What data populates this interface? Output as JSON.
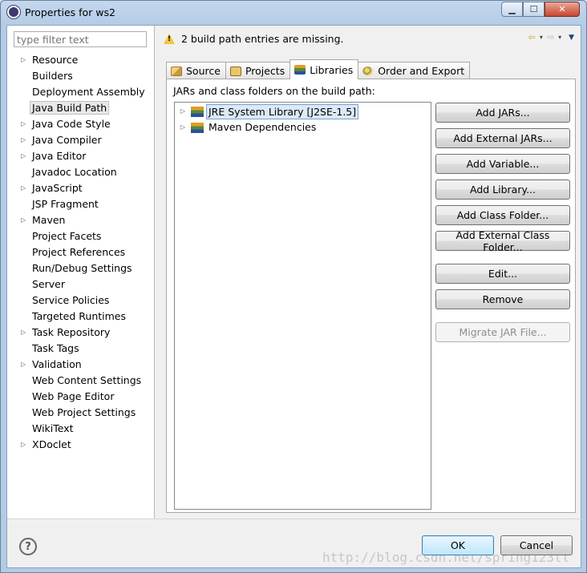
{
  "window": {
    "title": "Properties for ws2",
    "controls": {
      "minimize": "▁",
      "maximize": "☐",
      "close": "✕"
    }
  },
  "filter": {
    "placeholder": "type filter text"
  },
  "nav": {
    "items": [
      {
        "label": "Resource",
        "expandable": true
      },
      {
        "label": "Builders",
        "expandable": false
      },
      {
        "label": "Deployment Assembly",
        "expandable": false
      },
      {
        "label": "Java Build Path",
        "expandable": false,
        "selected": true
      },
      {
        "label": "Java Code Style",
        "expandable": true
      },
      {
        "label": "Java Compiler",
        "expandable": true
      },
      {
        "label": "Java Editor",
        "expandable": true
      },
      {
        "label": "Javadoc Location",
        "expandable": false
      },
      {
        "label": "JavaScript",
        "expandable": true
      },
      {
        "label": "JSP Fragment",
        "expandable": false
      },
      {
        "label": "Maven",
        "expandable": true
      },
      {
        "label": "Project Facets",
        "expandable": false
      },
      {
        "label": "Project References",
        "expandable": false
      },
      {
        "label": "Run/Debug Settings",
        "expandable": false
      },
      {
        "label": "Server",
        "expandable": false
      },
      {
        "label": "Service Policies",
        "expandable": false
      },
      {
        "label": "Targeted Runtimes",
        "expandable": false
      },
      {
        "label": "Task Repository",
        "expandable": true
      },
      {
        "label": "Task Tags",
        "expandable": false
      },
      {
        "label": "Validation",
        "expandable": true
      },
      {
        "label": "Web Content Settings",
        "expandable": false
      },
      {
        "label": "Web Page Editor",
        "expandable": false
      },
      {
        "label": "Web Project Settings",
        "expandable": false
      },
      {
        "label": "WikiText",
        "expandable": false
      },
      {
        "label": "XDoclet",
        "expandable": true
      }
    ]
  },
  "message": {
    "text": "2 build path entries are missing.",
    "icon": "warning-icon"
  },
  "history": {
    "back": "⇦",
    "forward": "⇨",
    "dropdown": "▾",
    "menu": "▼"
  },
  "tabs": [
    {
      "label": "Source",
      "icon": "source-folder-icon"
    },
    {
      "label": "Projects",
      "icon": "projects-icon"
    },
    {
      "label": "Libraries",
      "icon": "library-icon",
      "active": true
    },
    {
      "label": "Order and Export",
      "icon": "order-export-icon"
    }
  ],
  "libraries": {
    "subtitle": "JARs and class folders on the build path:",
    "tree": [
      {
        "label": "JRE System Library [J2SE-1.5]",
        "selected": true
      },
      {
        "label": "Maven Dependencies",
        "selected": false
      }
    ],
    "buttons": {
      "add_jars": "Add JARs...",
      "add_external_jars": "Add External JARs...",
      "add_variable": "Add Variable...",
      "add_library": "Add Library...",
      "add_class_folder": "Add Class Folder...",
      "add_external_class_folder": "Add External Class Folder...",
      "edit": "Edit...",
      "remove": "Remove",
      "migrate_jar": "Migrate JAR File..."
    }
  },
  "footer": {
    "help": "?",
    "ok": "OK",
    "cancel": "Cancel",
    "watermark": "http://blog.csdn.net/spring123tt"
  },
  "colors": {
    "accent": "#3c7fb1",
    "selection": "#dce9f8",
    "warning": "#f3c53a"
  }
}
